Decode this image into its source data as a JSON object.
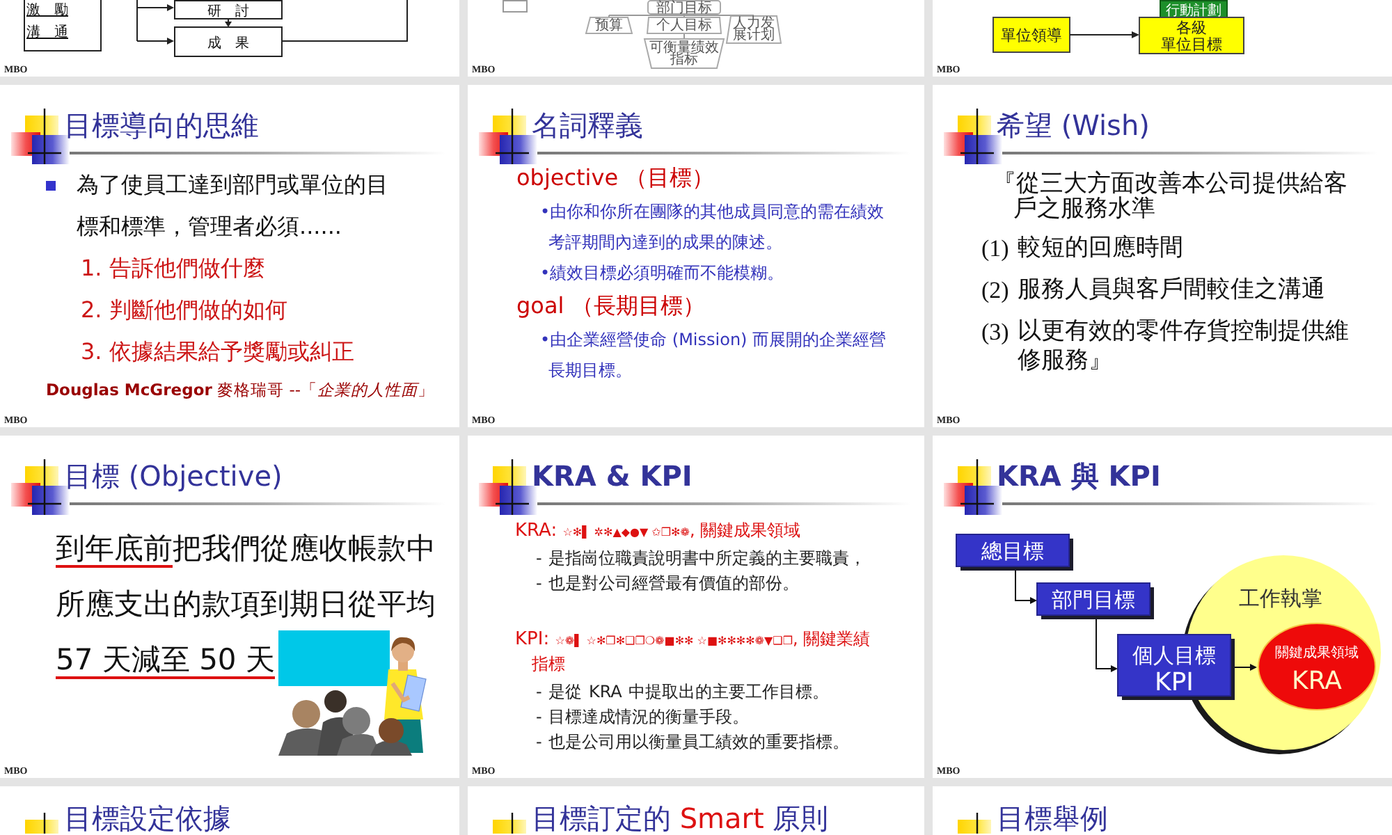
{
  "slides": [
    {
      "kind": "process_fragment",
      "labels": [
        {
          "text": "激　勵",
          "underlined": true
        },
        {
          "text": "溝　通",
          "underlined": true
        }
      ],
      "steps": [
        "研　討",
        "成　果"
      ],
      "footer": "MBO"
    },
    {
      "kind": "tree_fragment",
      "top_node": {
        "lines": [
          "部门目标"
        ]
      },
      "nodes": [
        {
          "lines": [
            "预算"
          ]
        },
        {
          "lines": [
            "个人目标"
          ]
        },
        {
          "lines": [
            "人力发",
            "展计划"
          ]
        }
      ],
      "bottom_node": {
        "lines": [
          "可衡量绩效",
          "指标"
        ]
      },
      "footer": "MBO"
    },
    {
      "kind": "unit_fragment",
      "plan_box": "行動計劃",
      "source_box": {
        "lines": [
          "單位領導"
        ]
      },
      "target_box": {
        "lines": [
          "各級",
          "單位目標"
        ]
      },
      "footer": "MBO"
    },
    {
      "kind": "bullet_list",
      "title": "目標導向的思維",
      "title_bold": false,
      "bullet": "為了使員工達到部門或單位的目標和標準，管理者必須......",
      "items": [
        "1. 告訴他們做什麼",
        "2. 判斷他們做的如何",
        "3. 依據結果給予獎勵或糾正"
      ],
      "citation": "**Douglas McGregor**  麥格瑞哥 --「*企業的人性面*」",
      "footer": "MBO"
    },
    {
      "kind": "definitions",
      "title": "名詞釋義",
      "title_bold": false,
      "terms": [
        {
          "term": "objective （目標）",
          "notes": [
            "•由你和你所在團隊的其他成員同意的需在績效考評期間內達到的成果的陳述。",
            "•績效目標必須明確而不能模糊。"
          ]
        },
        {
          "term": "goal （長期目標）",
          "notes": [
            "•由企業經營使命 (Mission) 而展開的企業經營長期目標。"
          ]
        }
      ],
      "footer": "MBO"
    },
    {
      "kind": "numbered_quote",
      "title": "希望 (Wish)",
      "title_bold": false,
      "intro": "『從三大方面改善本公司提供給客戶之服務水準",
      "items": [
        {
          "number": "(1)",
          "text": "較短的回應時間"
        },
        {
          "number": "(2)",
          "text": "服務人員與客戶間較佳之溝通"
        },
        {
          "number": "(3)",
          "text": "以更有效的零件存貨控制提供維修服務』"
        }
      ],
      "footer": "MBO"
    },
    {
      "kind": "statement",
      "title": "目標 (Objective)",
      "title_bold": false,
      "segments": [
        {
          "text": "到年底前",
          "underlined": true
        },
        {
          "text": "把我們從應收帳款中所應支出的款項到期日從平均",
          "underlined": false
        },
        {
          "text": "57 天減至 50 天",
          "underlined": true
        }
      ],
      "footer": "MBO"
    },
    {
      "kind": "term_list",
      "title": "KRA & KPI",
      "title_bold": true,
      "sections": [
        {
          "label": "KRA:",
          "code": "☆✻▌ ✲✻▲◆●▼ ✩❒✻❁",
          "meaning": ", 關鍵成果領域",
          "points": [
            "- 是指崗位職責說明書中所定義的主要職責，",
            "- 也是對公司經營最有價值的部份。"
          ]
        },
        {
          "label": "KPI:",
          "code": "☆❁▌ ☆✻❒✻❑❒❍❁■✻✻ ☆■✻✻✻✻❁▼❑❒",
          "meaning": ", 關鍵業績指標",
          "points": [
            "- 是從 KRA 中提取出的主要工作目標。",
            "- 目標達成情況的衡量手段。",
            "- 也是公司用以衡量員工績效的重要指標。"
          ]
        }
      ],
      "footer": "MBO"
    },
    {
      "kind": "kra_kpi_diagram",
      "title": "KRA 與 KPI",
      "title_bold": true,
      "goal_boxes": [
        "總目標",
        "部門目標",
        "個人目標"
      ],
      "kpi_label": "KPI",
      "circle_label": "工作執掌",
      "ellipse_caption": "關鍵成果領域",
      "ellipse_label": "KRA",
      "footer": "MBO"
    },
    {
      "kind": "title_only",
      "title_parts": [
        {
          "text": "目標設定依據",
          "accent": false
        }
      ]
    },
    {
      "kind": "title_only",
      "title_parts": [
        {
          "text": "目標訂定的 ",
          "accent": false
        },
        {
          "text": "Smart",
          "accent": true
        },
        {
          "text": " 原則",
          "accent": false
        }
      ]
    },
    {
      "kind": "title_only",
      "title_parts": [
        {
          "text": "目標舉例",
          "accent": false
        }
      ]
    }
  ]
}
